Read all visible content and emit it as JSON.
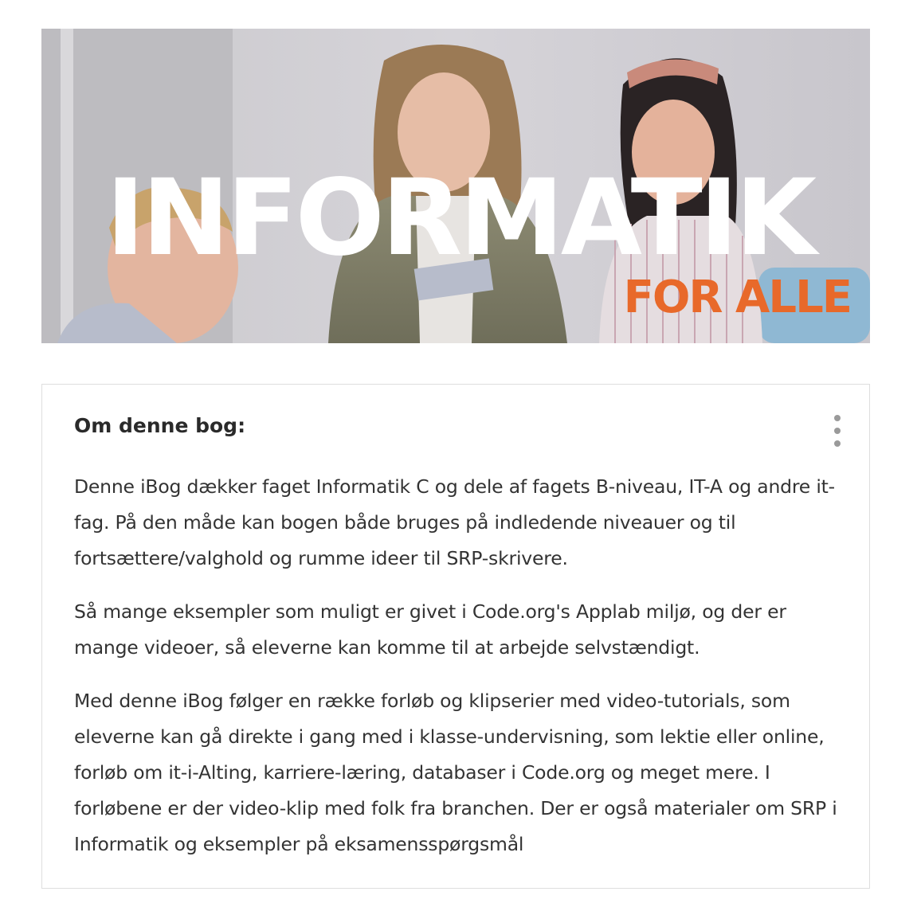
{
  "banner": {
    "title": "INFORMATIK",
    "subtitle": "FOR ALLE",
    "accent_color": "#e8692a",
    "image_description_icon": "photo-three-students"
  },
  "card": {
    "heading": "Om denne bog:",
    "menu_icon": "more-vertical-icon",
    "paragraphs": [
      "Denne iBog dækker faget Informatik C og dele af fagets B-niveau, IT-A og andre it-fag. På den måde kan bogen både bruges på indledende niveauer og til fortsættere/valghold og rumme ideer til SRP-skrivere.",
      "Så mange eksempler som muligt er givet i Code.org's Applab miljø, og der er mange videoer, så eleverne kan komme til at arbejde selvstændigt.",
      "Med denne iBog følger en række forløb og klipserier med video-tutorials, som eleverne kan gå direkte i gang med i klasse-undervisning, som lektie eller online, forløb om it-i-Alting, karriere-læring, databaser i Code.org og meget mere. I forløbene er der video-klip med folk fra branchen. Der er også materialer om SRP i Informatik og eksempler på eksamensspørgsmål"
    ]
  }
}
